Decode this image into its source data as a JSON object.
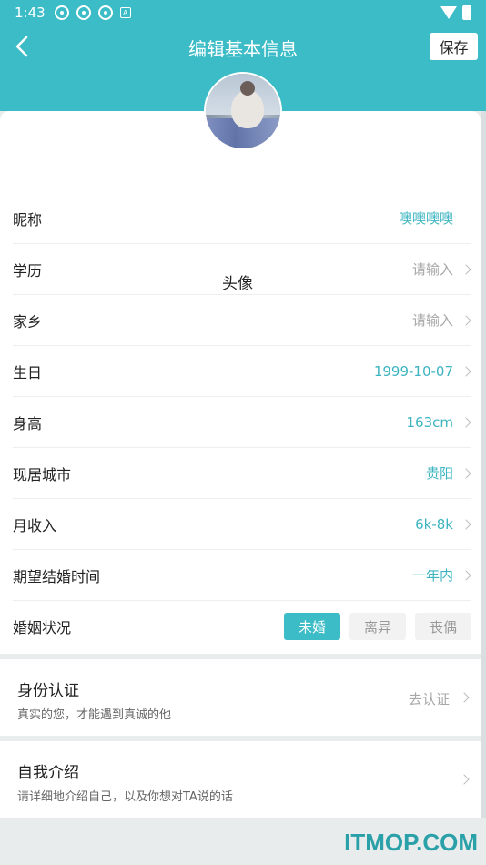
{
  "status": {
    "time": "1:43"
  },
  "nav": {
    "title": "编辑基本信息",
    "save_label": "保存",
    "back_icon": "chevron-left-icon"
  },
  "profile": {
    "avatar_label": "头像"
  },
  "fields": [
    {
      "label": "昵称",
      "value": "噢噢噢噢",
      "placeholder": false
    },
    {
      "label": "学历",
      "value": "请输入",
      "placeholder": true
    },
    {
      "label": "家乡",
      "value": "请输入",
      "placeholder": true
    },
    {
      "label": "生日",
      "value": "1999-10-07",
      "placeholder": false
    },
    {
      "label": "身高",
      "value": "163cm",
      "placeholder": false
    },
    {
      "label": "现居城市",
      "value": "贵阳",
      "placeholder": false
    },
    {
      "label": "月收入",
      "value": "6k-8k",
      "placeholder": false
    },
    {
      "label": "期望结婚时间",
      "value": "一年内",
      "placeholder": false
    }
  ],
  "marital": {
    "label": "婚姻状况",
    "options": [
      "未婚",
      "离异",
      "丧偶"
    ],
    "selected": "未婚"
  },
  "identity": {
    "title": "身份认证",
    "subtitle": "真实的您，才能遇到真诚的他",
    "action": "去认证"
  },
  "intro": {
    "title": "自我介绍",
    "subtitle": "请详细地介绍自己，以及你想对TA说的话"
  },
  "watermark": "ITMOP.COM",
  "colors": {
    "accent": "#3bbcc6",
    "value_text": "#3bb4c0",
    "placeholder_text": "#a8a8a8"
  }
}
